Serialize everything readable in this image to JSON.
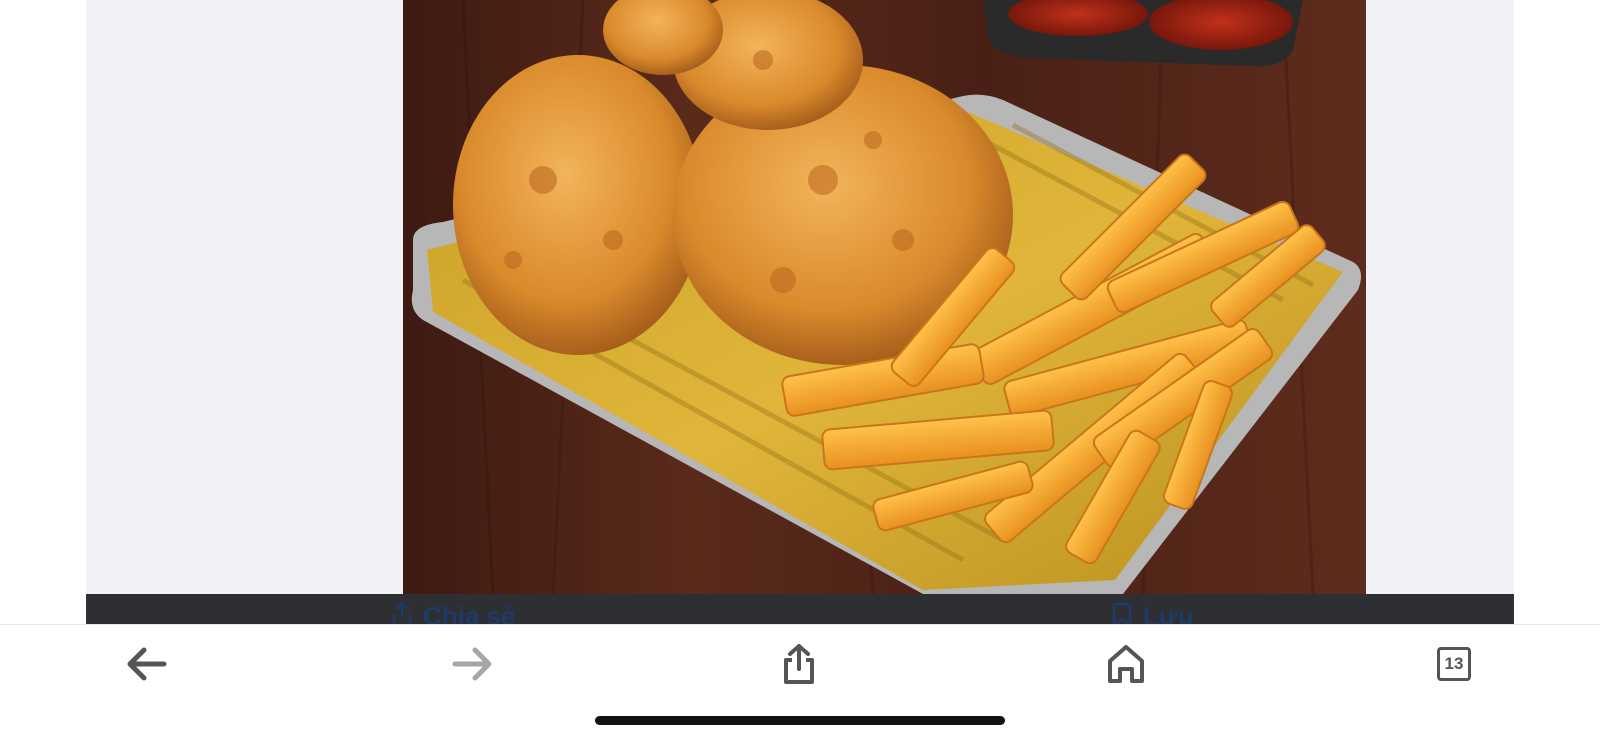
{
  "post": {
    "image_icon": "fried-chicken-and-fries-photo",
    "share_label": "Chia sẻ",
    "save_label": "Lưu"
  },
  "toolbar": {
    "back_icon": "arrow-left-icon",
    "forward_icon": "arrow-right-icon",
    "share_icon": "share-icon",
    "home_icon": "home-icon",
    "tab_count": "13"
  },
  "colors": {
    "toolbar_icon": "#555555",
    "toolbar_icon_disabled": "#a6a6a6",
    "panel_bg": "#f0f2f5",
    "action_bar_bg": "#2d2f33",
    "action_text": "#1f3a66"
  }
}
